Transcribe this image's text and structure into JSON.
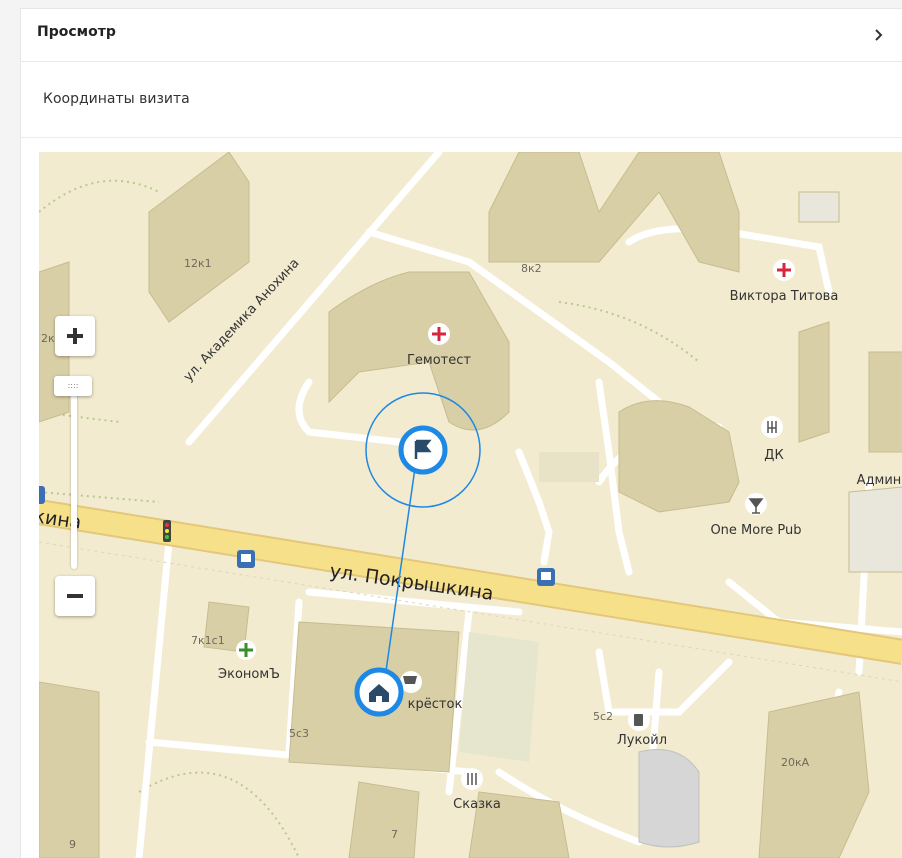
{
  "header": {
    "title": "Просмотр"
  },
  "section": {
    "label": "Координаты визита"
  },
  "map": {
    "streets": {
      "anokhina": "ул. Академика Анохина",
      "pokryshkina": "ул. Покрышкина",
      "pokryshkina_partial": "кина"
    },
    "pois": {
      "gemotest": "Гемотест",
      "viktora_titova": "Виктора Титова",
      "dk": "ДК",
      "one_more_pub": "One More Pub",
      "ekonom": "ЭкономЪ",
      "perekrestok": "кpёсток",
      "lukoil": "Лукойл",
      "skazka": "Сказка",
      "admin": "Админ"
    },
    "buildings": {
      "b12k1": "12к1",
      "b8k2": "8к2",
      "b2k": "2к",
      "b7k1c1": "7к1с1",
      "b5c3": "5с3",
      "b5c2": "5с2",
      "b20ka": "20кА",
      "b9": "9",
      "b7": "7"
    },
    "zoom": {
      "plus": "+",
      "minus": "−",
      "handle": "::::"
    },
    "colors": {
      "land": "#f2ebcf",
      "road": "#ffffff",
      "major_road": "#f7e08a",
      "building": "#d9cfa6",
      "accent": "#1e88e5",
      "med": "#d6263d"
    }
  }
}
